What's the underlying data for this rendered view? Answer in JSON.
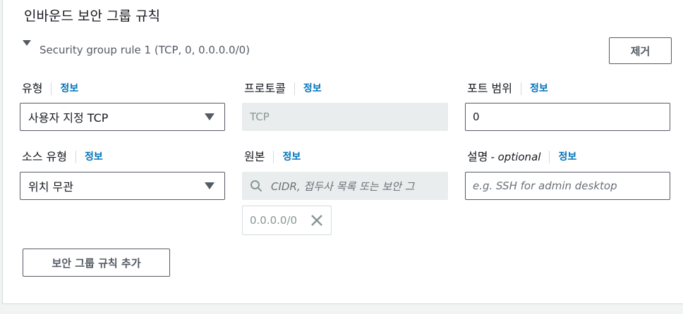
{
  "section": {
    "title": "인바운드 보안 그룹 규칙"
  },
  "rule": {
    "title": "Security group rule 1 (TCP, 0, 0.0.0.0/0)",
    "remove_label": "제거"
  },
  "info_label": "정보",
  "fields": {
    "type": {
      "label": "유형",
      "value": "사용자 지정 TCP"
    },
    "protocol": {
      "label": "프로토콜",
      "value": "TCP"
    },
    "port_range": {
      "label": "포트 범위",
      "value": "0"
    },
    "source_type": {
      "label": "소스 유형",
      "value": "위치 무관"
    },
    "source": {
      "label": "원본",
      "placeholder": "CIDR, 접두사 목록 또는 보안 그",
      "token": "0.0.0.0/0"
    },
    "description": {
      "label": "설명",
      "optional": "- optional",
      "placeholder": "e.g. SSH for admin desktop"
    }
  },
  "add_rule_label": "보안 그룹 규칙 추가",
  "colors": {
    "info_link": "#0073bb",
    "border": "#545b64",
    "disabled_bg": "#eaeded"
  },
  "icons": {
    "expand": "caret-down-icon",
    "select": "dropdown-arrow-icon",
    "search": "search-icon",
    "remove_token": "close-icon"
  }
}
